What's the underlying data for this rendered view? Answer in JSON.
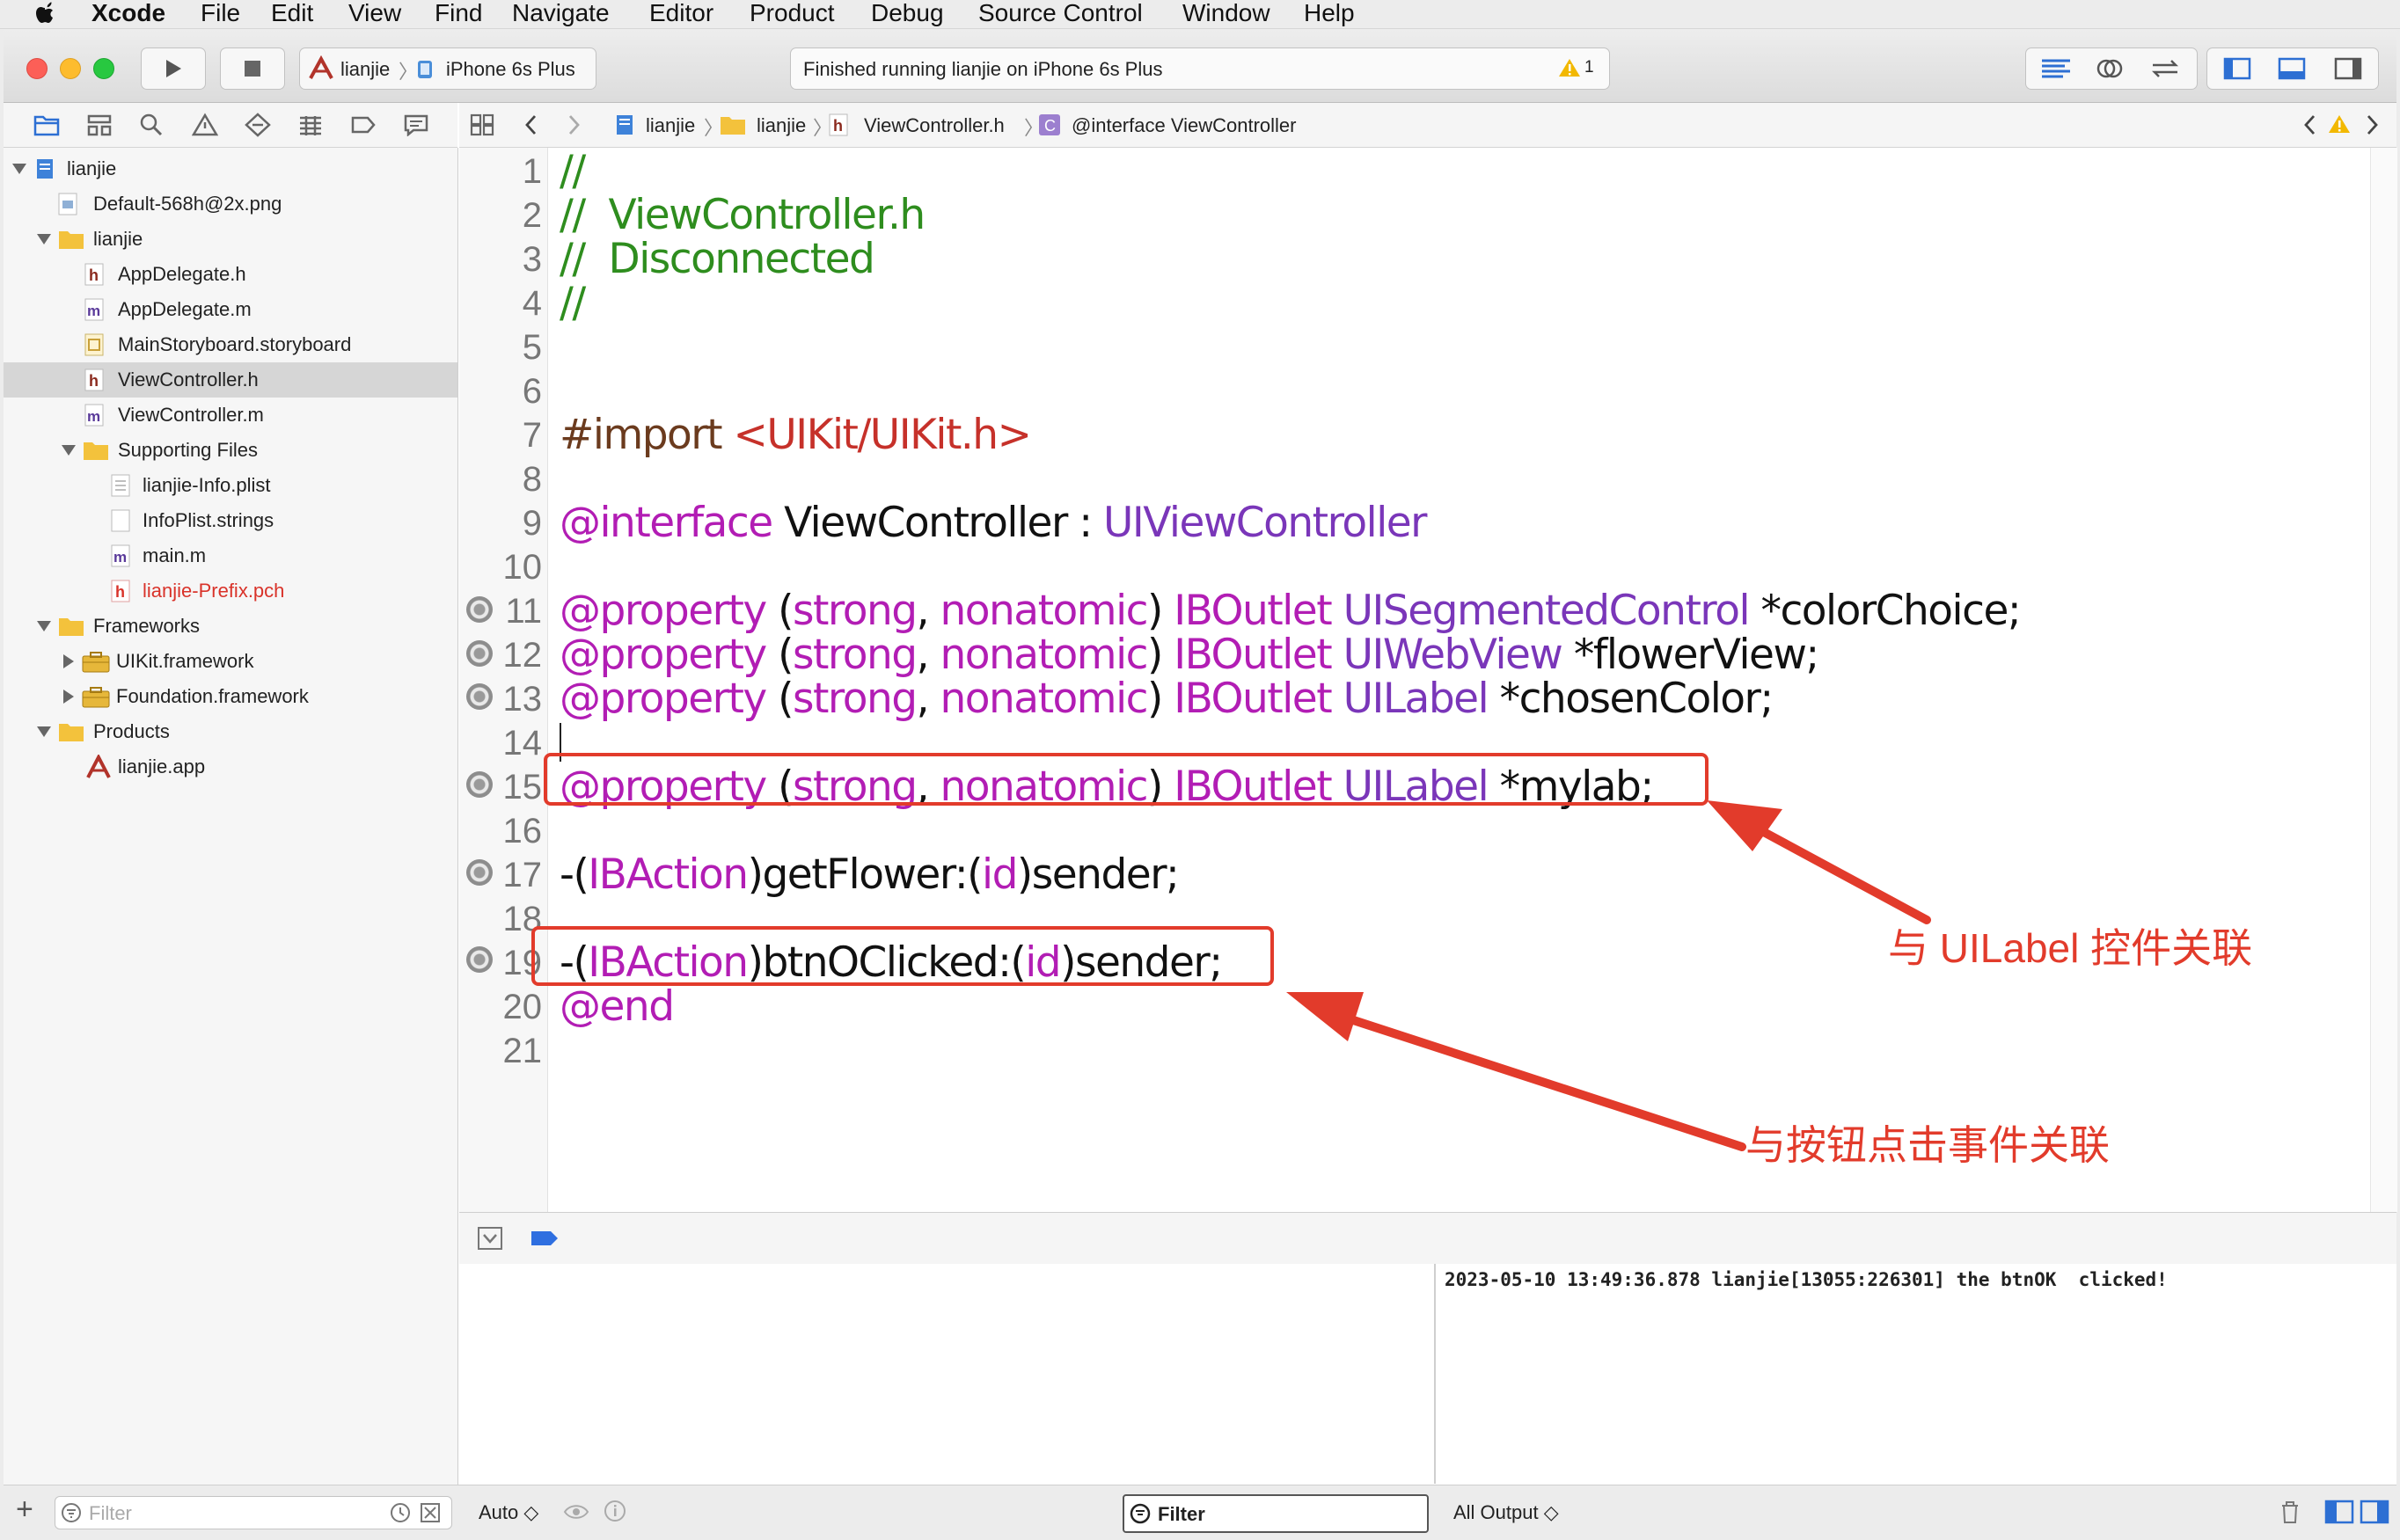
{
  "menubar": {
    "apple": "",
    "app_name": "Xcode",
    "items": [
      "File",
      "Edit",
      "View",
      "Find",
      "Navigate",
      "Editor",
      "Product",
      "Debug",
      "Source Control",
      "Window",
      "Help"
    ]
  },
  "toolbar": {
    "scheme": "lianjie",
    "device": "iPhone 6s Plus",
    "status": "Finished running lianjie on iPhone 6s Plus",
    "warning_count": "1"
  },
  "jumpbar": {
    "crumbs": [
      "lianjie",
      "lianjie",
      "ViewController.h",
      "@interface ViewController"
    ]
  },
  "navigator": {
    "items": [
      {
        "label": "lianjie",
        "icon": "project-icon"
      },
      {
        "label": "Default-568h@2x.png",
        "icon": "image-file-icon"
      },
      {
        "label": "lianjie",
        "icon": "folder-icon"
      },
      {
        "label": "AppDelegate.h",
        "icon": "header-file-icon"
      },
      {
        "label": "AppDelegate.m",
        "icon": "implementation-file-icon"
      },
      {
        "label": "MainStoryboard.storyboard",
        "icon": "storyboard-file-icon"
      },
      {
        "label": "ViewController.h",
        "icon": "header-file-icon"
      },
      {
        "label": "ViewController.m",
        "icon": "implementation-file-icon"
      },
      {
        "label": "Supporting Files",
        "icon": "folder-icon"
      },
      {
        "label": "lianjie-Info.plist",
        "icon": "plist-file-icon"
      },
      {
        "label": "InfoPlist.strings",
        "icon": "strings-file-icon"
      },
      {
        "label": "main.m",
        "icon": "implementation-file-icon"
      },
      {
        "label": "lianjie-Prefix.pch",
        "icon": "header-file-icon"
      },
      {
        "label": "Frameworks",
        "icon": "folder-icon"
      },
      {
        "label": "UIKit.framework",
        "icon": "framework-icon"
      },
      {
        "label": "Foundation.framework",
        "icon": "framework-icon"
      },
      {
        "label": "Products",
        "icon": "folder-icon"
      },
      {
        "label": "lianjie.app",
        "icon": "app-icon"
      }
    ],
    "filter_placeholder": "Filter",
    "missing_file_color": "#d9332a"
  },
  "editor": {
    "line_numbers": [
      "1",
      "2",
      "3",
      "4",
      "5",
      "6",
      "7",
      "8",
      "9",
      "10",
      "11",
      "12",
      "13",
      "14",
      "15",
      "16",
      "17",
      "18",
      "19",
      "20",
      "21"
    ],
    "code": {
      "l1": "//",
      "l2": "//  ViewController.h",
      "l3": "//  Disconnected",
      "l4": "//",
      "l7_import": "#import ",
      "l7_path": "<UIKit/UIKit.h>",
      "l9_kw": "@interface",
      "l9_name": " ViewController : ",
      "l9_super": "UIViewController",
      "prop_kw": "@property",
      "prop_open": " (",
      "prop_strong": "strong",
      "prop_comma": ", ",
      "prop_nonatomic": "nonatomic",
      "prop_close": ") ",
      "prop_outlet": "IBOutlet",
      "l11_type": " UISegmentedControl",
      "l11_var": " *colorChoice;",
      "l12_type": " UIWebView",
      "l12_var": " *flowerView;",
      "l13_type": " UILabel",
      "l13_var": " *chosenColor;",
      "l15_type": " UILabel",
      "l15_var": " *mylab;",
      "act_open": "-(",
      "act_kw": "IBAction",
      "act_close": ")",
      "l17_sel": "getFlower:(",
      "id_kw": "id",
      "sender": ")sender;",
      "l19_sel": "btnOClicked:(",
      "l20_end": "@end"
    }
  },
  "annotations": {
    "label_link": "与 UILabel 控件关联",
    "button_link": "与按钮点击事件关联",
    "color": "#e23b2b"
  },
  "debug": {
    "console_line": "2023-05-10 13:49:36.878 lianjie[13055:226301] the btnOK  clicked!",
    "auto_label": "Auto ◇",
    "filter_label": "Filter",
    "output_label": "All Output ◇"
  }
}
